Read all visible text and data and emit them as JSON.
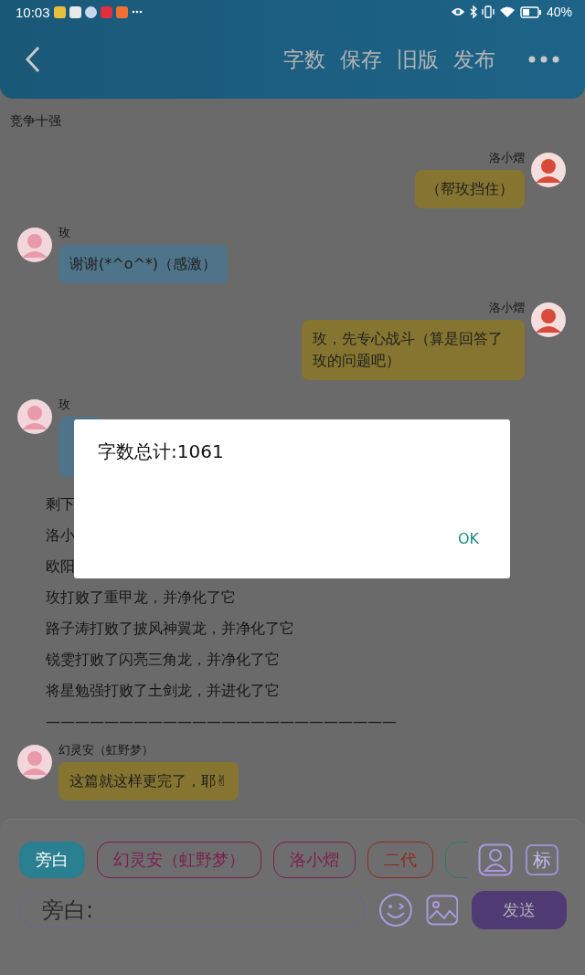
{
  "status_bar": {
    "time": "10:03",
    "battery": "40%"
  },
  "header": {
    "actions": [
      "字数",
      "保存",
      "旧版",
      "发布"
    ]
  },
  "title": "竞争十强",
  "messages": [
    {
      "kind": "right",
      "name": "洛小熠",
      "text": "（帮玫挡住）",
      "color": "#857530"
    },
    {
      "kind": "left",
      "name": "玫",
      "text": "谢谢(*^o^*)（感激）",
      "color": "#4f7489"
    },
    {
      "kind": "right",
      "name": "洛小熠",
      "text": "玫，先专心战斗（算是回答了玫的问题吧）",
      "color": "#857530"
    },
    {
      "kind": "left",
      "name": "玫",
      "color": "#4f7489"
    },
    {
      "kind": "narration",
      "text": "剩下"
    },
    {
      "kind": "narration",
      "text": "洛小"
    },
    {
      "kind": "narration",
      "text": "欧阳"
    },
    {
      "kind": "narration",
      "text": "玫打败了重甲龙，并净化了它"
    },
    {
      "kind": "narration",
      "text": "路子涛打败了披风神翼龙，并净化了它"
    },
    {
      "kind": "narration",
      "text": "锐雯打败了闪亮三角龙，并净化了它"
    },
    {
      "kind": "narration",
      "text": "将星勉强打败了土剑龙，并进化了它"
    },
    {
      "kind": "narration",
      "text": "————————————————————————"
    },
    {
      "kind": "left",
      "name": "幻灵安（虹野梦）",
      "text": "这篇就这样更完了，耶✌",
      "color": "#857530"
    }
  ],
  "composer": {
    "roles": [
      {
        "label": "旁白",
        "selected": true,
        "color": "#2a7f90"
      },
      {
        "label": "幻灵安（虹野梦）",
        "selected": false,
        "color": "#7c1f4e"
      },
      {
        "label": "洛小熠",
        "selected": false,
        "color": "#7c1f4e"
      },
      {
        "label": "二代",
        "selected": false,
        "color": "#8e2c22"
      },
      {
        "selected": false,
        "color": "#2a7a70"
      }
    ],
    "tag": "标",
    "placeholder": "旁白:",
    "send": "发送"
  },
  "dialog": {
    "title": "字数总计:1061",
    "ok": "OK"
  }
}
